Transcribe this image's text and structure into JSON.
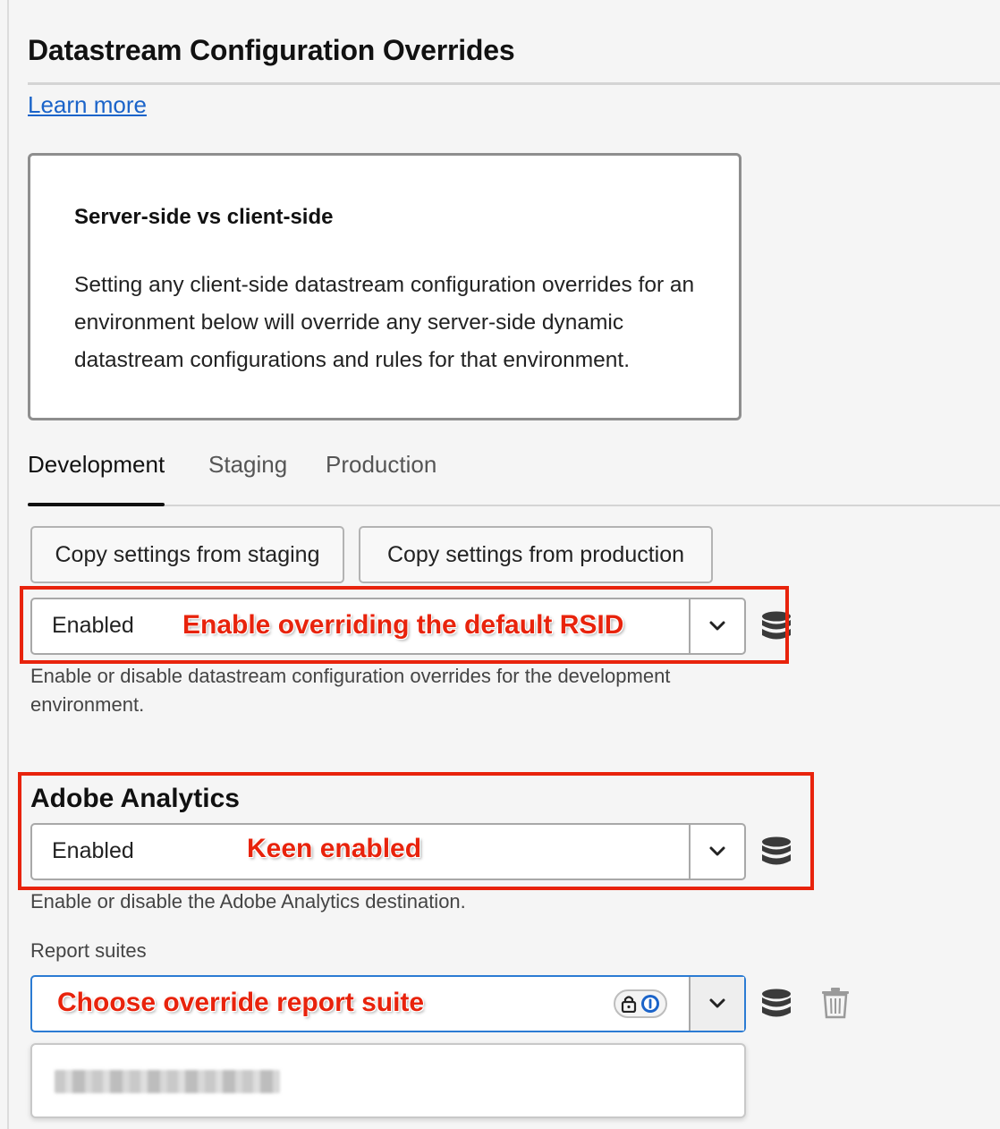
{
  "page": {
    "title": "Datastream Configuration Overrides",
    "learn_more": "Learn more"
  },
  "info": {
    "heading": "Server-side vs client-side",
    "body": "Setting any client-side datastream configuration overrides for an environment below will override any server-side dynamic datastream configurations and rules for that environment."
  },
  "tabs": [
    {
      "label": "Development",
      "active": true
    },
    {
      "label": "Staging",
      "active": false
    },
    {
      "label": "Production",
      "active": false
    }
  ],
  "buttons": {
    "copy_staging": "Copy settings from staging",
    "copy_production": "Copy settings from production"
  },
  "overrides": {
    "select_value": "Enabled",
    "help": "Enable or disable datastream configuration overrides for the development environment."
  },
  "analytics": {
    "title": "Adobe Analytics",
    "select_value": "Enabled",
    "help": "Enable or disable the Adobe Analytics destination.",
    "report_suites_label": "Report suites",
    "report_suite_value": ""
  },
  "annotations": {
    "rsid": "Enable overriding the default RSID",
    "keen": "Keen enabled",
    "choose": "Choose override report suite"
  },
  "colors": {
    "annotation_red": "#e8230c",
    "link_blue": "#1a63c9",
    "focus_blue": "#2b7bd3"
  },
  "icons": [
    "chevron-down-icon",
    "database-icon",
    "trash-icon",
    "lock-icon",
    "password-manager-icon"
  ]
}
